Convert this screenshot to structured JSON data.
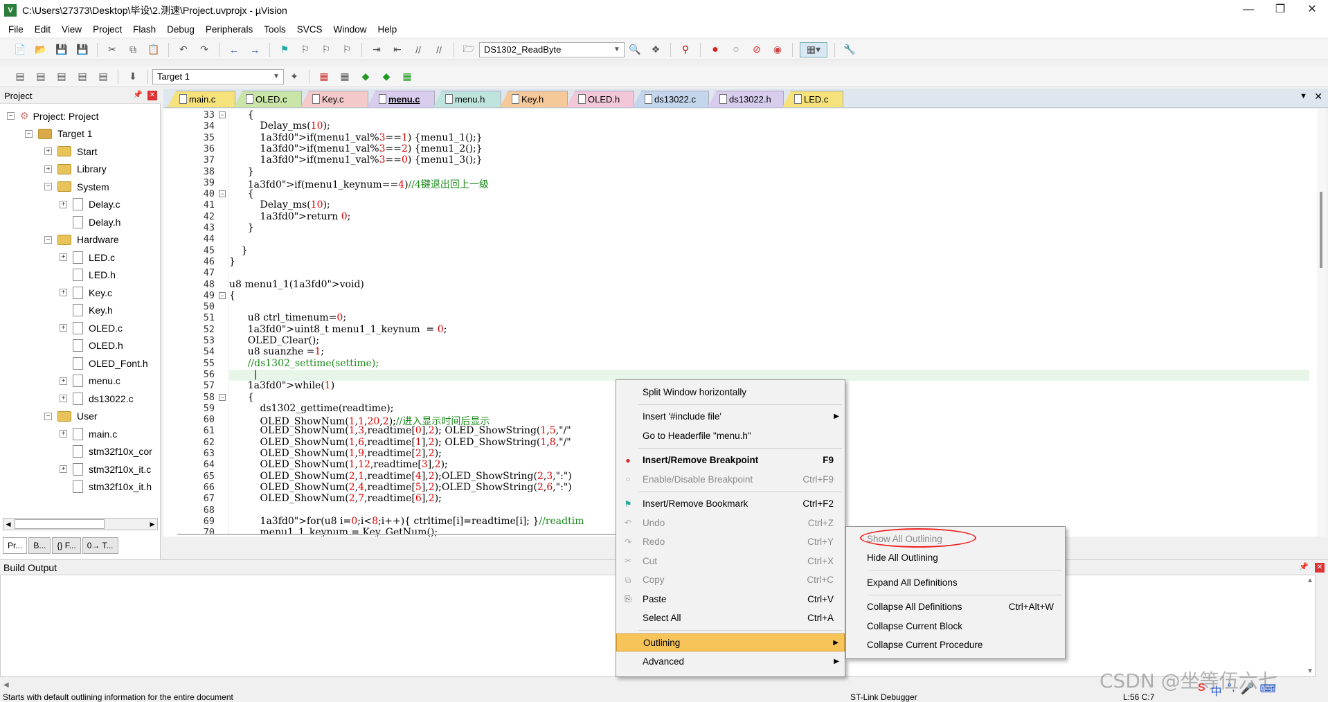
{
  "window": {
    "title": "C:\\Users\\27373\\Desktop\\毕设\\2.测速\\Project.uvprojx - µVision",
    "app_icon": "V"
  },
  "menubar": [
    "File",
    "Edit",
    "View",
    "Project",
    "Flash",
    "Debug",
    "Peripherals",
    "Tools",
    "SVCS",
    "Window",
    "Help"
  ],
  "toolbar1": {
    "function_combo": "DS1302_ReadByte"
  },
  "toolbar2": {
    "target_combo": "Target 1"
  },
  "project_panel": {
    "title": "Project",
    "tree": [
      {
        "label": "Project: Project",
        "level": 0,
        "exp": "-",
        "type": "proj"
      },
      {
        "label": "Target 1",
        "level": 1,
        "exp": "-",
        "type": "target"
      },
      {
        "label": "Start",
        "level": 2,
        "exp": "+",
        "type": "folder"
      },
      {
        "label": "Library",
        "level": 2,
        "exp": "+",
        "type": "folder"
      },
      {
        "label": "System",
        "level": 2,
        "exp": "-",
        "type": "folder"
      },
      {
        "label": "Delay.c",
        "level": 3,
        "exp": "+",
        "type": "file"
      },
      {
        "label": "Delay.h",
        "level": 3,
        "exp": "",
        "type": "file"
      },
      {
        "label": "Hardware",
        "level": 2,
        "exp": "-",
        "type": "folder"
      },
      {
        "label": "LED.c",
        "level": 3,
        "exp": "+",
        "type": "file"
      },
      {
        "label": "LED.h",
        "level": 3,
        "exp": "",
        "type": "file"
      },
      {
        "label": "Key.c",
        "level": 3,
        "exp": "+",
        "type": "file"
      },
      {
        "label": "Key.h",
        "level": 3,
        "exp": "",
        "type": "file"
      },
      {
        "label": "OLED.c",
        "level": 3,
        "exp": "+",
        "type": "file"
      },
      {
        "label": "OLED.h",
        "level": 3,
        "exp": "",
        "type": "file"
      },
      {
        "label": "OLED_Font.h",
        "level": 3,
        "exp": "",
        "type": "file"
      },
      {
        "label": "menu.c",
        "level": 3,
        "exp": "+",
        "type": "file"
      },
      {
        "label": "ds13022.c",
        "level": 3,
        "exp": "+",
        "type": "file"
      },
      {
        "label": "User",
        "level": 2,
        "exp": "-",
        "type": "folder"
      },
      {
        "label": "main.c",
        "level": 3,
        "exp": "+",
        "type": "file"
      },
      {
        "label": "stm32f10x_cor",
        "level": 3,
        "exp": "",
        "type": "file"
      },
      {
        "label": "stm32f10x_it.c",
        "level": 3,
        "exp": "+",
        "type": "file"
      },
      {
        "label": "stm32f10x_it.h",
        "level": 3,
        "exp": "",
        "type": "file"
      }
    ],
    "bottom_tabs": [
      "Pr...",
      "B...",
      "{} F...",
      "0→ T..."
    ]
  },
  "editor_tabs": [
    {
      "label": "main.c",
      "color": "#f6e27a"
    },
    {
      "label": "OLED.c",
      "color": "#c9e6a8"
    },
    {
      "label": "Key.c",
      "color": "#f3c9c9"
    },
    {
      "label": "menu.c",
      "color": "#d9cdee",
      "active": true
    },
    {
      "label": "menu.h",
      "color": "#bfe3dd"
    },
    {
      "label": "Key.h",
      "color": "#f6c99b"
    },
    {
      "label": "OLED.h",
      "color": "#f2c7da"
    },
    {
      "label": "ds13022.c",
      "color": "#c4d6ec"
    },
    {
      "label": "ds13022.h",
      "color": "#d9cdee"
    },
    {
      "label": "LED.c",
      "color": "#f6e27a"
    }
  ],
  "code": [
    {
      "n": "33",
      "f": "-",
      "t": "      {"
    },
    {
      "n": "34",
      "f": "",
      "t": "          Delay_ms(10);"
    },
    {
      "n": "35",
      "f": "",
      "t": "          if(menu1_val%3==1) {menu1_1();}"
    },
    {
      "n": "36",
      "f": "",
      "t": "          if(menu1_val%3==2) {menu1_2();}"
    },
    {
      "n": "37",
      "f": "",
      "t": "          if(menu1_val%3==0) {menu1_3();}"
    },
    {
      "n": "38",
      "f": "",
      "t": "      }"
    },
    {
      "n": "39",
      "f": "",
      "t": "      if(menu1_keynum==4)//4键退出回上一级"
    },
    {
      "n": "40",
      "f": "-",
      "t": "      {"
    },
    {
      "n": "41",
      "f": "",
      "t": "          Delay_ms(10);"
    },
    {
      "n": "42",
      "f": "",
      "t": "          return 0;"
    },
    {
      "n": "43",
      "f": "",
      "t": "      }"
    },
    {
      "n": "44",
      "f": "",
      "t": ""
    },
    {
      "n": "45",
      "f": "",
      "t": "    }"
    },
    {
      "n": "46",
      "f": "",
      "t": "}"
    },
    {
      "n": "47",
      "f": "",
      "t": ""
    },
    {
      "n": "48",
      "f": "",
      "t": "u8 menu1_1(void)"
    },
    {
      "n": "49",
      "f": "-",
      "t": "{"
    },
    {
      "n": "50",
      "f": "",
      "t": ""
    },
    {
      "n": "51",
      "f": "",
      "t": "      u8 ctrl_timenum=0;"
    },
    {
      "n": "52",
      "f": "",
      "t": "      uint8_t menu1_1_keynum  = 0;"
    },
    {
      "n": "53",
      "f": "",
      "t": "      OLED_Clear();"
    },
    {
      "n": "54",
      "f": "",
      "t": "      u8 suanzhe =1;"
    },
    {
      "n": "55",
      "f": "",
      "t": "      //ds1302_settime(settime);"
    },
    {
      "n": "56",
      "f": "",
      "t": "        |"
    },
    {
      "n": "57",
      "f": "",
      "t": "      while(1)"
    },
    {
      "n": "58",
      "f": "-",
      "t": "      {"
    },
    {
      "n": "59",
      "f": "",
      "t": "          ds1302_gettime(readtime);"
    },
    {
      "n": "60",
      "f": "",
      "t": "          OLED_ShowNum(1,1,20,2);//进入显示时间后显示"
    },
    {
      "n": "61",
      "f": "",
      "t": "          OLED_ShowNum(1,3,readtime[0],2); OLED_ShowString(1,5,\"/\""
    },
    {
      "n": "62",
      "f": "",
      "t": "          OLED_ShowNum(1,6,readtime[1],2); OLED_ShowString(1,8,\"/\""
    },
    {
      "n": "63",
      "f": "",
      "t": "          OLED_ShowNum(1,9,readtime[2],2);"
    },
    {
      "n": "64",
      "f": "",
      "t": "          OLED_ShowNum(1,12,readtime[3],2);"
    },
    {
      "n": "65",
      "f": "",
      "t": "          OLED_ShowNum(2,1,readtime[4],2);OLED_ShowString(2,3,\":\")"
    },
    {
      "n": "66",
      "f": "",
      "t": "          OLED_ShowNum(2,4,readtime[5],2);OLED_ShowString(2,6,\":\")"
    },
    {
      "n": "67",
      "f": "",
      "t": "          OLED_ShowNum(2,7,readtime[6],2);"
    },
    {
      "n": "68",
      "f": "",
      "t": ""
    },
    {
      "n": "69",
      "f": "",
      "t": "          for(u8 i=0;i<8;i++){ ctrltime[i]=readtime[i]; }//readtim"
    },
    {
      "n": "70",
      "f": "",
      "t": "          menu1_1_keynum = Key_GetNum();"
    }
  ],
  "context_menu": [
    {
      "label": "Split Window horizontally",
      "sc": "",
      "type": "item"
    },
    {
      "type": "sep"
    },
    {
      "label": "Insert '#include file'",
      "sub": true,
      "type": "item"
    },
    {
      "label": "Go to Headerfile \"menu.h\"",
      "type": "item"
    },
    {
      "type": "sep"
    },
    {
      "label": "Insert/Remove Breakpoint",
      "sc": "F9",
      "type": "item",
      "bold": true,
      "icon": "bp"
    },
    {
      "label": "Enable/Disable Breakpoint",
      "sc": "Ctrl+F9",
      "type": "item",
      "disabled": true,
      "icon": "bp-off"
    },
    {
      "type": "sep"
    },
    {
      "label": "Insert/Remove Bookmark",
      "sc": "Ctrl+F2",
      "type": "item",
      "icon": "bookmark"
    },
    {
      "label": "Undo",
      "sc": "Ctrl+Z",
      "type": "item",
      "disabled": true,
      "icon": "undo"
    },
    {
      "label": "Redo",
      "sc": "Ctrl+Y",
      "type": "item",
      "disabled": true,
      "icon": "redo"
    },
    {
      "label": "Cut",
      "sc": "Ctrl+X",
      "type": "item",
      "disabled": true,
      "icon": "cut"
    },
    {
      "label": "Copy",
      "sc": "Ctrl+C",
      "type": "item",
      "disabled": true,
      "icon": "copy"
    },
    {
      "label": "Paste",
      "sc": "Ctrl+V",
      "type": "item",
      "icon": "paste"
    },
    {
      "label": "Select All",
      "sc": "Ctrl+A",
      "type": "item"
    },
    {
      "type": "sep"
    },
    {
      "label": "Outlining",
      "sub": true,
      "type": "item",
      "highlight": true
    },
    {
      "label": "Advanced",
      "sub": true,
      "type": "item"
    }
  ],
  "submenu": [
    {
      "label": "Show All Outlining",
      "sc": "",
      "type": "item",
      "disabled": true,
      "circled": true
    },
    {
      "label": "Hide All Outlining",
      "sc": "",
      "type": "item"
    },
    {
      "type": "sep"
    },
    {
      "label": "Expand All Definitions",
      "sc": "",
      "type": "item"
    },
    {
      "type": "sep"
    },
    {
      "label": "Collapse All Definitions",
      "sc": "Ctrl+Alt+W",
      "type": "item"
    },
    {
      "label": "Collapse Current Block",
      "sc": "",
      "type": "item"
    },
    {
      "label": "Collapse Current Procedure",
      "sc": "",
      "type": "item"
    }
  ],
  "build_output": {
    "title": "Build Output"
  },
  "status": {
    "message": "Starts with default outlining information for the entire document",
    "debugger": "ST-Link Debugger",
    "position": "L:56 C:7"
  },
  "watermark": "CSDN @坐等伍六七"
}
